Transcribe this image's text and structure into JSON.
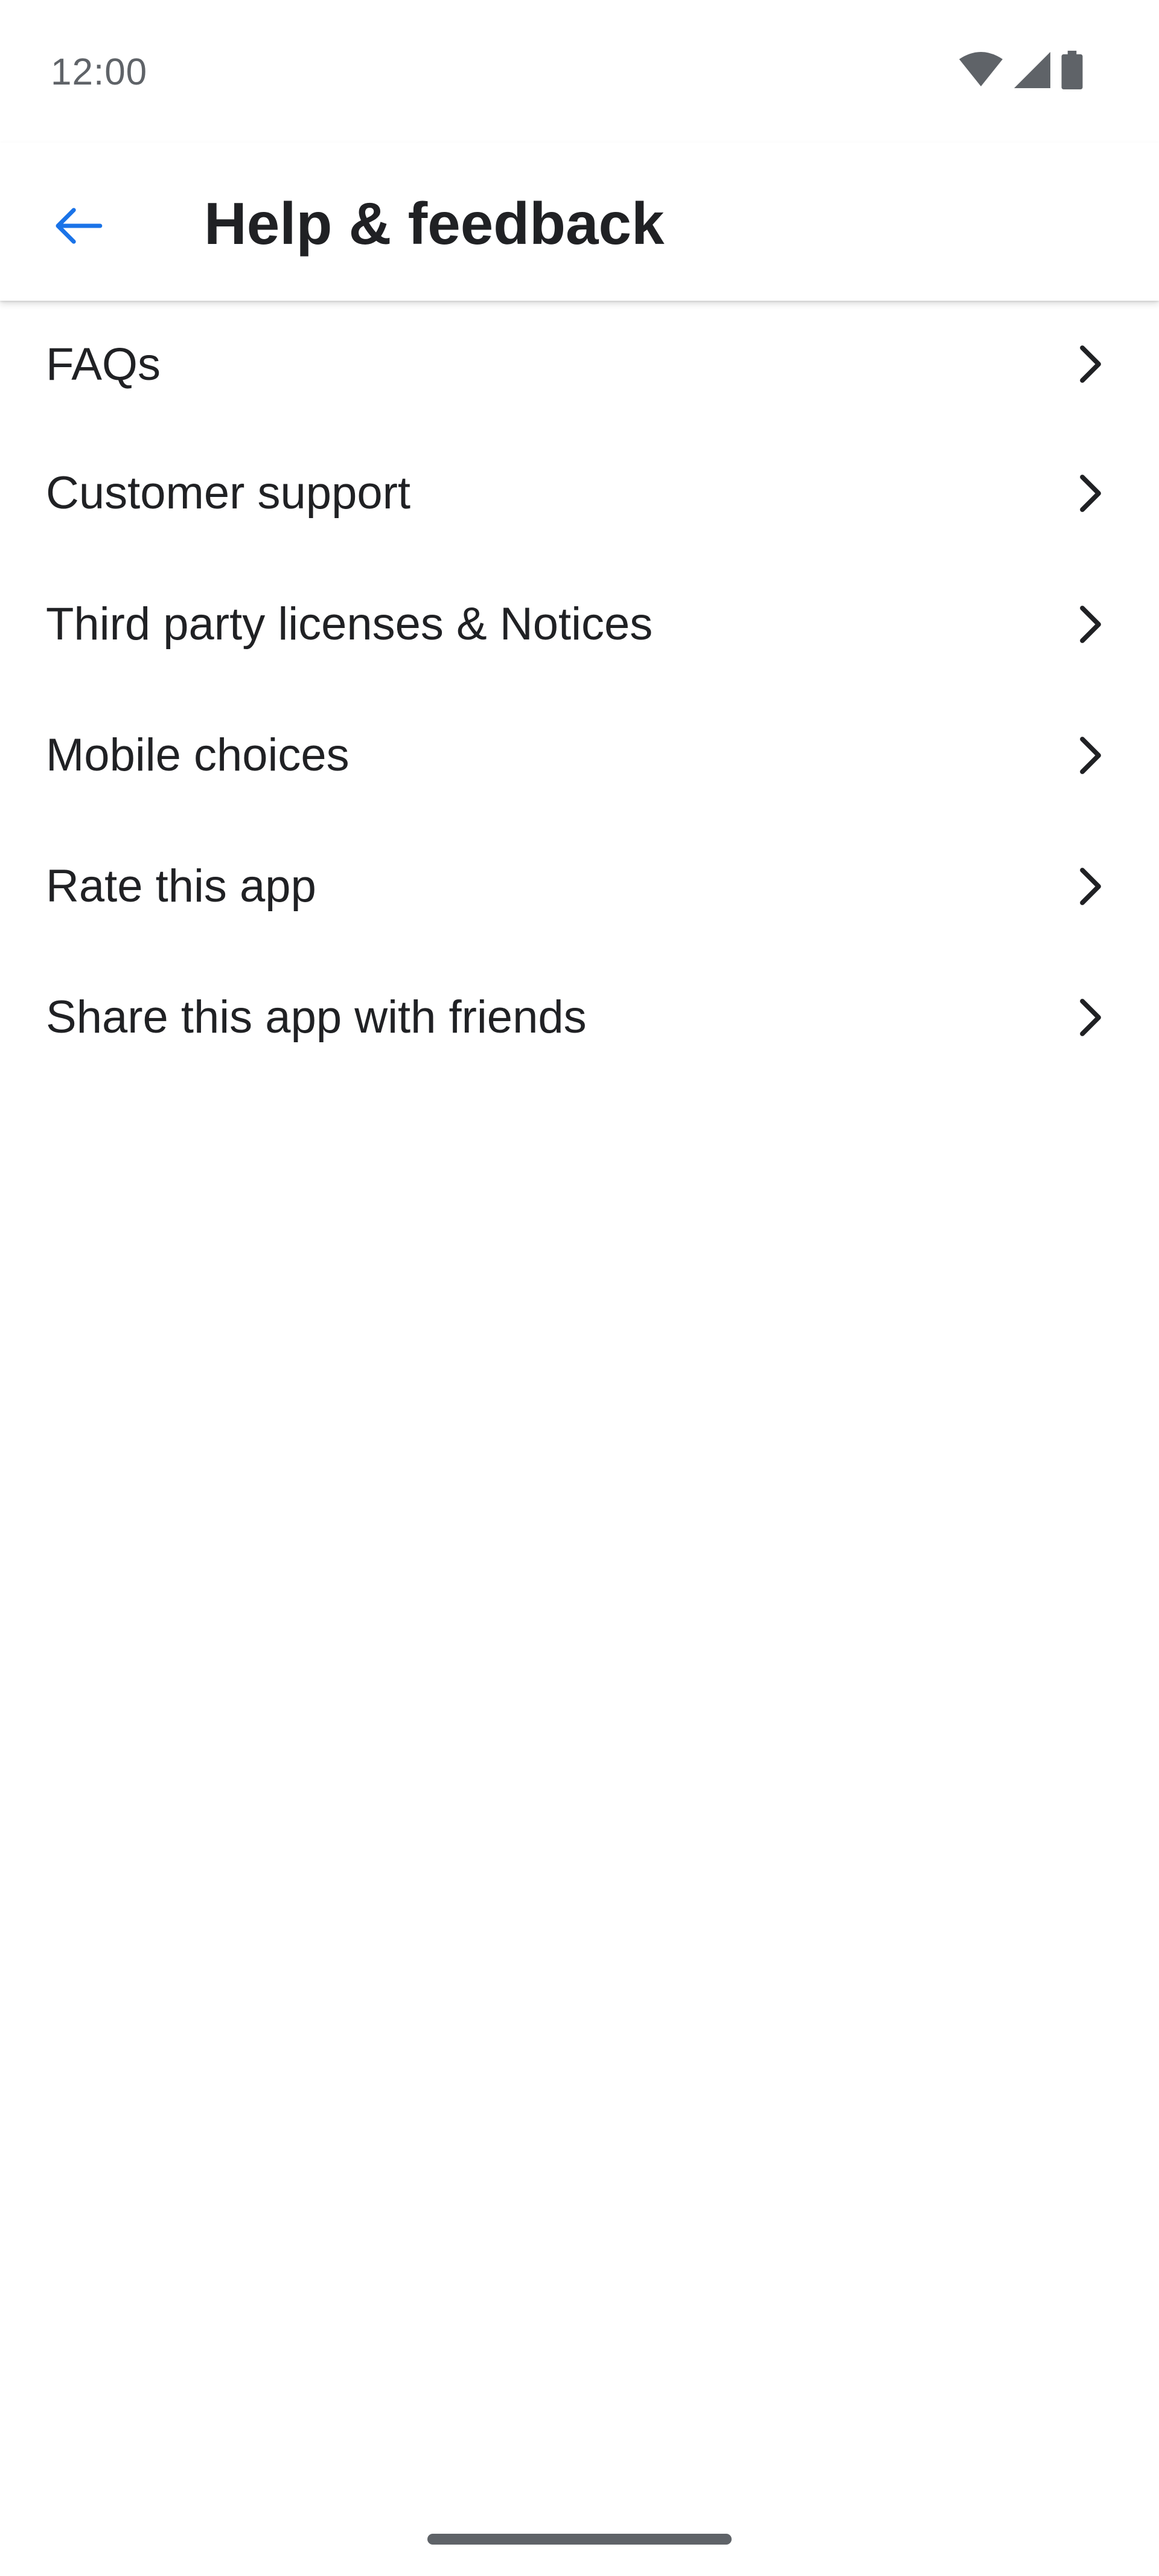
{
  "status_bar": {
    "time": "12:00",
    "icons": [
      "wifi-icon",
      "cellular-signal-icon",
      "battery-icon"
    ]
  },
  "app_bar": {
    "back_icon": "arrow-back-icon",
    "title": "Help & feedback",
    "accent_color": "#1a73e8"
  },
  "menu": {
    "items": [
      {
        "label": "FAQs",
        "icon": "chevron-right-icon"
      },
      {
        "label": "Customer support",
        "icon": "chevron-right-icon"
      },
      {
        "label": "Third party licenses & Notices",
        "icon": "chevron-right-icon"
      },
      {
        "label": "Mobile choices",
        "icon": "chevron-right-icon"
      },
      {
        "label": "Rate this app",
        "icon": "chevron-right-icon"
      },
      {
        "label": "Share this app with friends",
        "icon": "chevron-right-icon"
      }
    ]
  }
}
